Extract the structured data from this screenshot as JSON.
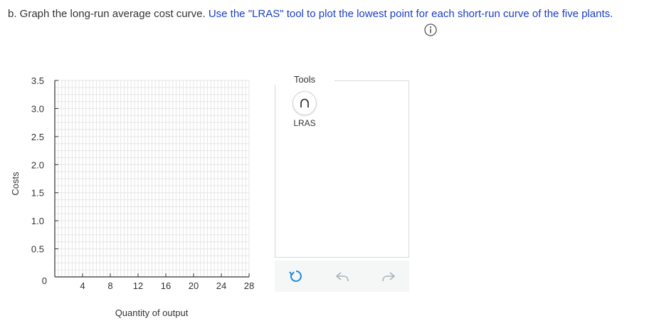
{
  "question": {
    "prefix": "b. Graph the long-run average cost curve.",
    "instruction": "Use the \"LRAS\" tool to plot the lowest point for each short-run curve of the five plants."
  },
  "chart_data": {
    "type": "scatter",
    "title": "",
    "xlabel": "Quantity of output",
    "ylabel": "Costs",
    "xlim": [
      0,
      28
    ],
    "ylim": [
      0,
      3.5
    ],
    "x_ticks": [
      4,
      8,
      12,
      16,
      20,
      24,
      28
    ],
    "y_ticks": [
      "0.5",
      "1.0",
      "1.5",
      "2.0",
      "2.5",
      "3.0",
      "3.5"
    ],
    "origin_label": "0",
    "grid": true,
    "series": [],
    "grid_color": "#e6e6e6",
    "axis_color": "#333333"
  },
  "tools": {
    "title": "Tools",
    "items": [
      {
        "label": "LRAS",
        "icon": "arch-curve-icon"
      }
    ]
  },
  "actions": {
    "reset_icon": "reset-icon",
    "undo_icon": "undo-icon",
    "redo_icon": "redo-icon",
    "reset_color": "#1f8bd6",
    "disabled_color": "#a8b4bd"
  }
}
